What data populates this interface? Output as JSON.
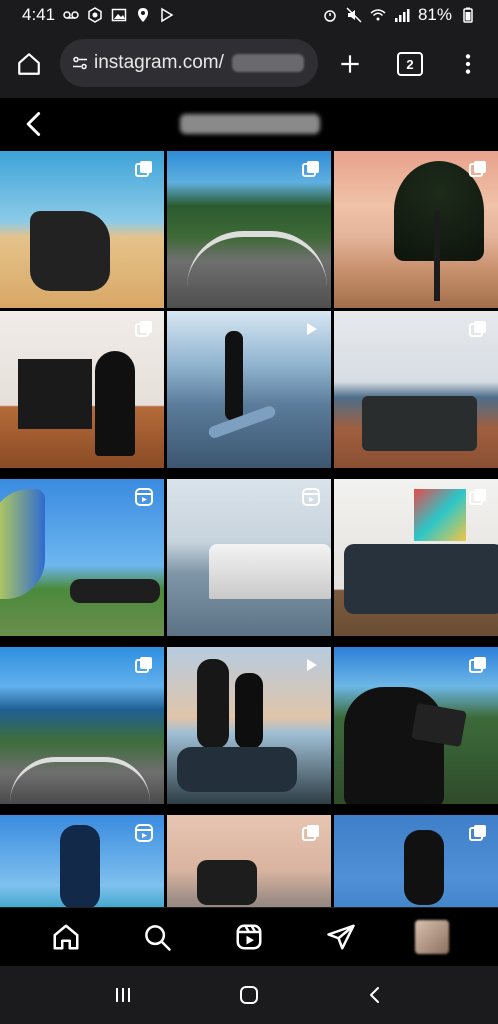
{
  "status": {
    "time": "4:41",
    "battery": "81%"
  },
  "browser": {
    "url": "instagram.com/",
    "tabs_count": "2"
  },
  "grid": {
    "tiles": [
      {
        "type": "carousel"
      },
      {
        "type": "carousel"
      },
      {
        "type": "carousel"
      },
      {
        "type": "carousel"
      },
      {
        "type": "video"
      },
      {
        "type": "carousel"
      },
      {
        "type": "reel"
      },
      {
        "type": "reel"
      },
      {
        "type": "carousel"
      },
      {
        "type": "carousel"
      },
      {
        "type": "video"
      },
      {
        "type": "carousel"
      },
      {
        "type": "reel"
      },
      {
        "type": "carousel"
      },
      {
        "type": "carousel"
      }
    ]
  },
  "bottom_nav": {
    "items": [
      "home-icon",
      "search-icon",
      "reels-icon",
      "direct-icon",
      "profile-avatar"
    ]
  },
  "system_nav": {
    "items": [
      "recents-icon",
      "home-button-icon",
      "back-icon"
    ]
  }
}
